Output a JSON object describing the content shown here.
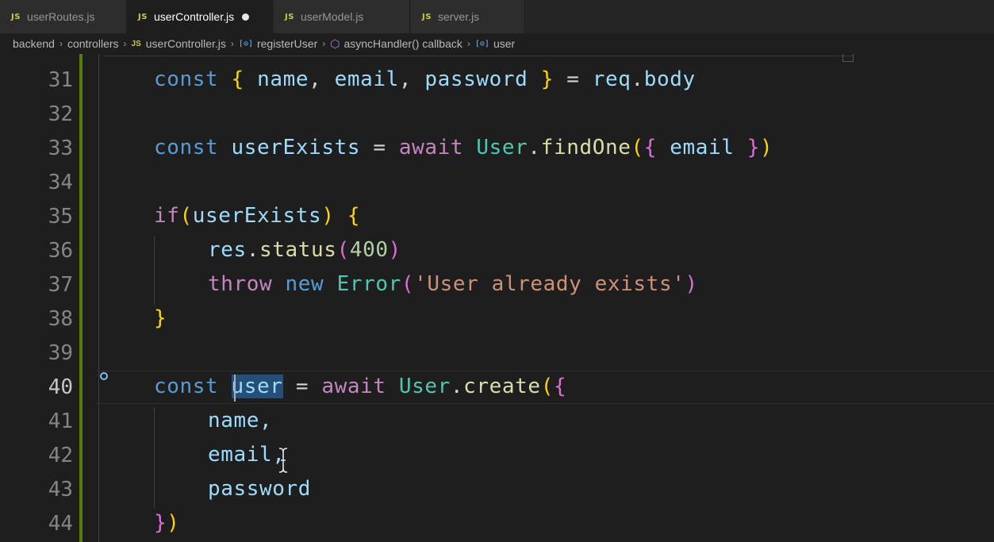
{
  "tabs": [
    {
      "label": "userRoutes.js",
      "icon": "JS",
      "active": false
    },
    {
      "label": "userController.js",
      "icon": "JS",
      "active": true,
      "modified": true
    },
    {
      "label": "userModel.js",
      "icon": "JS",
      "active": false
    },
    {
      "label": "server.js",
      "icon": "JS",
      "active": false
    }
  ],
  "breadcrumb": {
    "backend": "backend",
    "controllers": "controllers",
    "file": "userController.js",
    "file_icon": "JS",
    "register": "registerUser",
    "callback": "asyncHandler() callback",
    "variable": "user"
  },
  "code": {
    "line_numbers": [
      "31",
      "32",
      "33",
      "34",
      "35",
      "36",
      "37",
      "38",
      "39",
      "40",
      "41",
      "42",
      "43",
      "44"
    ],
    "l31": {
      "const": "const",
      "open": "{",
      "name": "name",
      "c1": ", ",
      "email": "email",
      "c2": ", ",
      "password": "password",
      "close": "}",
      "eq": " = ",
      "req": "req",
      "dot": ".",
      "body": "body"
    },
    "l33": {
      "const": "const",
      "userExists": "userExists",
      "eq": " = ",
      "await": "await",
      "User": "User",
      "dot": ".",
      "findOne": "findOne",
      "paren_open": "(",
      "brace_open": "{",
      "email": " email ",
      "brace_close": "}",
      "paren_close": ")"
    },
    "l35": {
      "if": "if",
      "paren_open": "(",
      "userExists": "userExists",
      "paren_close": ")",
      "brace": " {"
    },
    "l36": {
      "res": "res",
      "dot": ".",
      "status": "status",
      "paren_open": "(",
      "num": "400",
      "paren_close": ")"
    },
    "l37": {
      "throw": "throw",
      "new": "new",
      "Error": "Error",
      "paren_open": "(",
      "message": "'User already exists'",
      "paren_close": ")"
    },
    "l38": {
      "brace": "}"
    },
    "l40": {
      "const": "const",
      "user": "user",
      "eq": " = ",
      "await": "await",
      "User": "User",
      "dot": ".",
      "create": "create",
      "paren_open": "(",
      "brace_open": "{"
    },
    "l41": {
      "text": "name,"
    },
    "l42": {
      "text": "email,"
    },
    "l43": {
      "text": "password"
    },
    "l44": {
      "brace": "}",
      "paren": ")"
    }
  },
  "colors": {
    "background": "#1e1e1e",
    "keyword": "#569cd6",
    "control": "#c586c0",
    "variable": "#9cdcfe",
    "function": "#dcdcaa",
    "class": "#4ec9b0",
    "string": "#ce9178",
    "number": "#b5cea8",
    "selection": "#264f78"
  }
}
